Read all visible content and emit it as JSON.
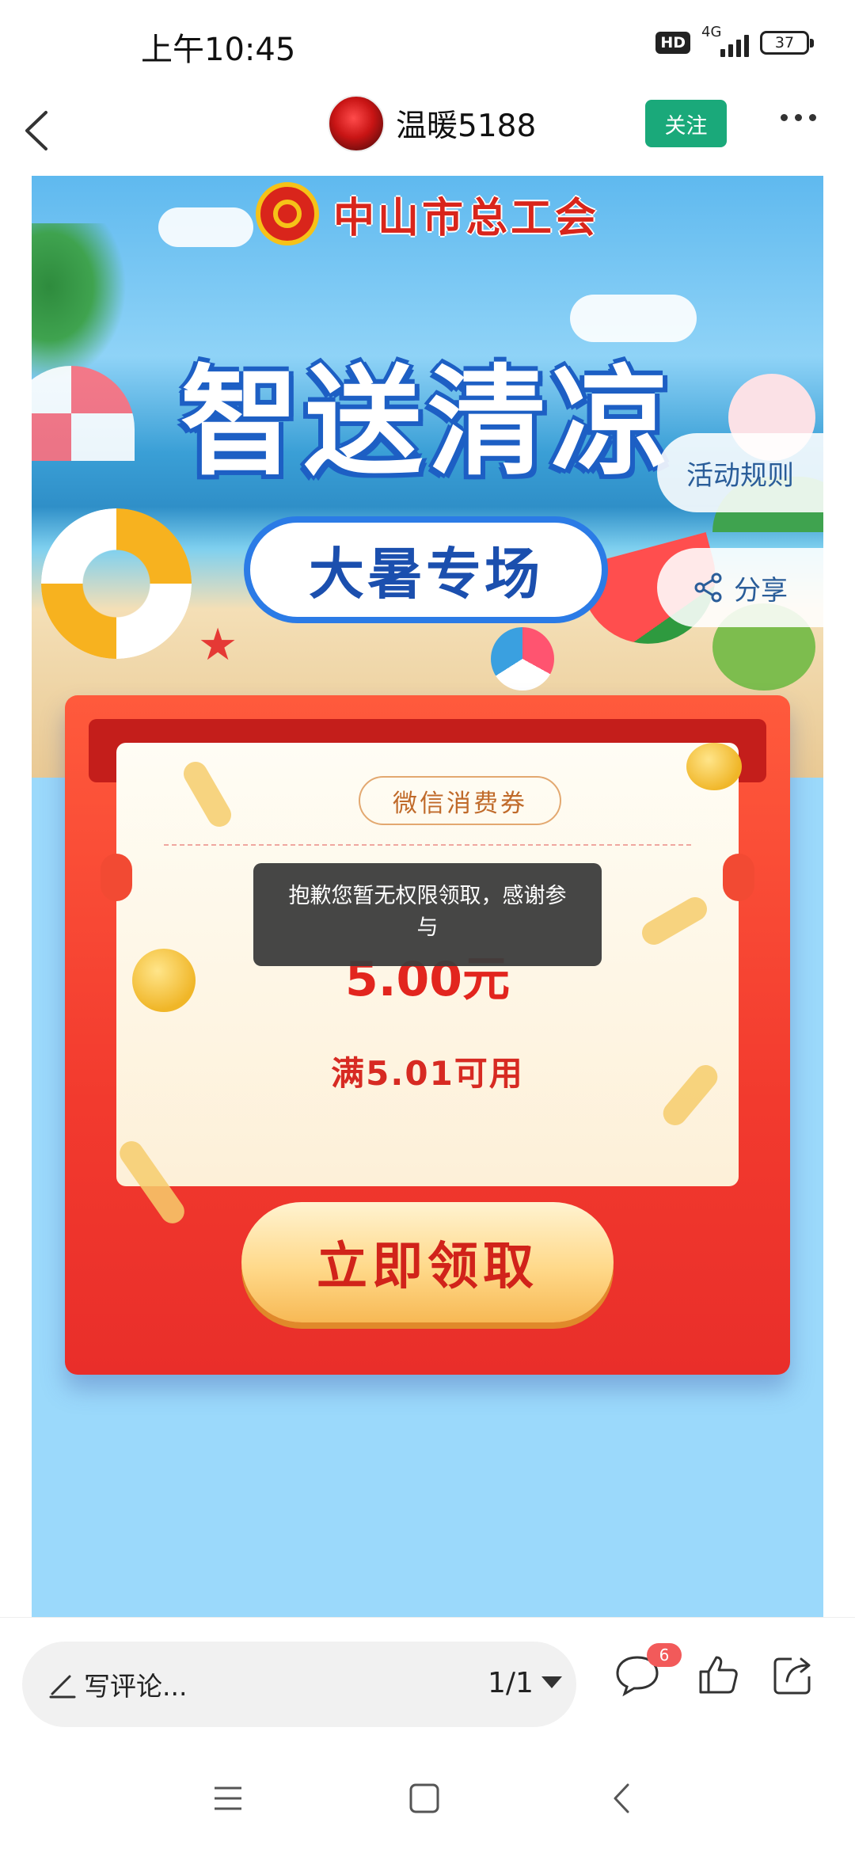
{
  "status_bar": {
    "time": "上午10:45",
    "hd": "HD",
    "network": "4G",
    "battery": "37"
  },
  "header": {
    "username": "温暖5188",
    "follow_label": "关注"
  },
  "banner": {
    "org_name": "中山市总工会",
    "title": "智送清凉",
    "subtitle": "大暑专场",
    "rules_label": "活动规则",
    "share_label": "分享"
  },
  "coupon": {
    "tag": "微信消费券",
    "amount": "5.00元",
    "condition": "满5.01可用",
    "claim_label": "立即领取"
  },
  "toast": {
    "message": "抱歉您暂无权限领取，感谢参与"
  },
  "bottom_bar": {
    "comment_placeholder": "写评论...",
    "page_indicator": "1/1",
    "comment_count": "6"
  },
  "colors": {
    "follow": "#1aa97a",
    "card_red": "#f23a2e",
    "sky": "#9bd9fb"
  }
}
